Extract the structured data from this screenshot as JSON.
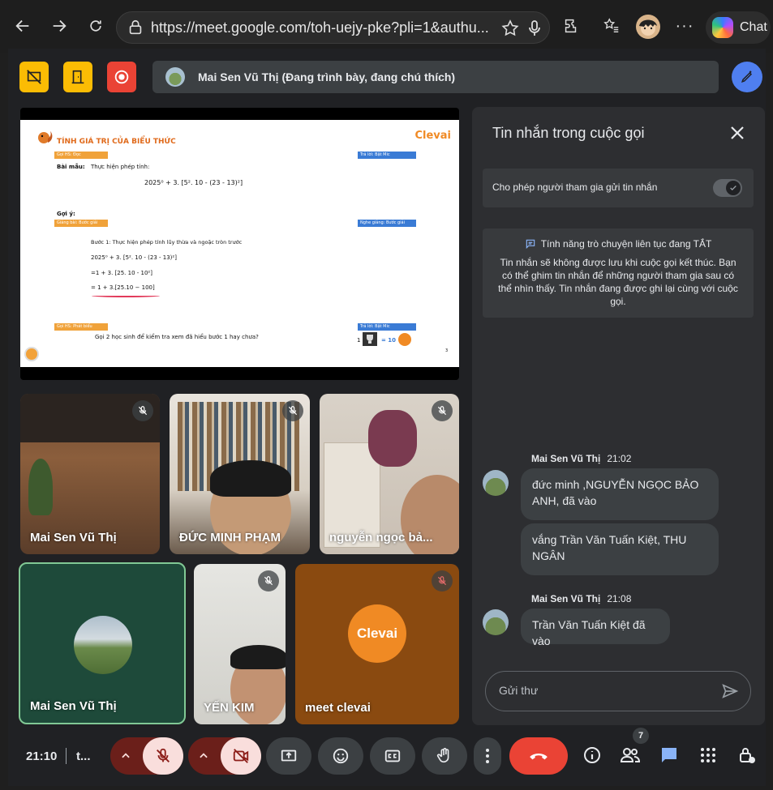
{
  "browser": {
    "url": "https://meet.google.com/toh-uejy-pke?pli=1&authu...",
    "chat_label": "Chat"
  },
  "meet": {
    "presenter_text": "Mai Sen Vũ Thị (Đang trình bày, đang chú thích)",
    "slide": {
      "title": "TÍNH GIÁ TRỊ CỦA BIỂU THỨC",
      "brand": "Clevai",
      "tag1": "Gọi HS: Đọc",
      "tag2": "Trả lời: Bật Mic",
      "tag3": "Giảng bài: Bước giải",
      "tag4": "Nghe giảng: Bước giải",
      "tag5": "Gọi HS: Phát biểu",
      "tag6": "Trả lời: Bật Mic",
      "sample_label": "Bài mẫu:",
      "sample_text": "Thực hiện phép tính:",
      "expr": "2025⁰ + 3. [5². 10 - (23 - 13)²]",
      "hint": "Gợi ý:",
      "step1": "Bước 1: Thực hiện phép tính lũy thừa và ngoặc tròn trước",
      "step2": "2025⁰ + 3. [5². 10 - (23  - 13)²]",
      "step3": "=1 + 3. [25. 10 - 10²]",
      "step4": "= 1 + 3.[25.10 − 100]",
      "ask": "Gọi 2 học sinh để kiểm tra xem đã hiểu bước 1 hay chưa?",
      "score": "1",
      "score_eq": "= 10",
      "page": "3"
    },
    "tiles": [
      {
        "name": "Mai Sen Vũ Thị"
      },
      {
        "name": "ĐỨC MINH PHẠM"
      },
      {
        "name": "nguyễn ngọc bả..."
      },
      {
        "name": "Mai Sen Vũ Thị"
      },
      {
        "name": "YẾN KIM"
      },
      {
        "name": "meet clevai",
        "logo": "Clevai"
      }
    ],
    "chat": {
      "title": "Tin nhắn trong cuộc gọi",
      "allow_label": "Cho phép người tham gia gửi tin nhắn",
      "notice_head": "Tính năng trò chuyện liên tục đang TẮT",
      "notice_body": "Tin nhắn sẽ không được lưu khi cuộc gọi kết thúc. Bạn có thể ghim tin nhắn để những người tham gia sau có thể nhìn thấy. Tin nhắn đang được ghi lại cùng với cuộc gọi.",
      "messages": [
        {
          "sender": "Mai Sen Vũ Thị",
          "time": "21:02",
          "bubbles": [
            "đức minh ,NGUYỄN NGỌC BẢO ANH, đã vào",
            "vắng  Trần Văn Tuấn Kiệt, THU NGÂN"
          ]
        },
        {
          "sender": "Mai Sen Vũ Thị",
          "time": "21:08",
          "bubbles": [
            "Trần Văn Tuấn Kiệt đã vào"
          ]
        }
      ],
      "input_placeholder": "Gửi thư"
    },
    "bottom": {
      "time": "21:10",
      "meeting_code": "t...",
      "participants_count": "7"
    }
  }
}
